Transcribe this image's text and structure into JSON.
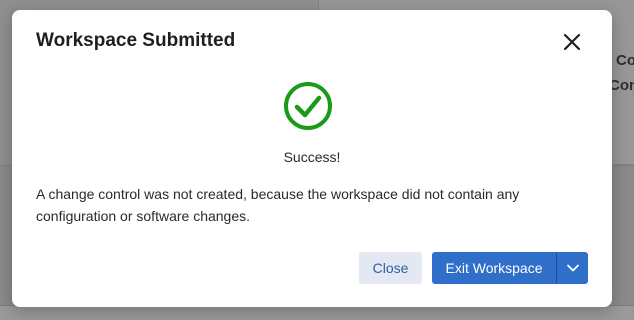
{
  "background": {
    "card_text_line1": "Co",
    "card_text_line2": "Con"
  },
  "modal": {
    "title": "Workspace Submitted",
    "status_text": "Success!",
    "message": "A change control was not created, because the workspace did not contain any configuration or software changes.",
    "close_button_label": "Close",
    "primary_button_label": "Exit Workspace",
    "icons": {
      "close": "close-icon",
      "success": "check-circle-icon",
      "caret": "chevron-down-icon"
    }
  },
  "colors": {
    "success_green": "#1a9a1a",
    "primary_blue": "#2f6ec9",
    "secondary_bg": "#e3e8f3",
    "secondary_text": "#2d5ea5"
  }
}
